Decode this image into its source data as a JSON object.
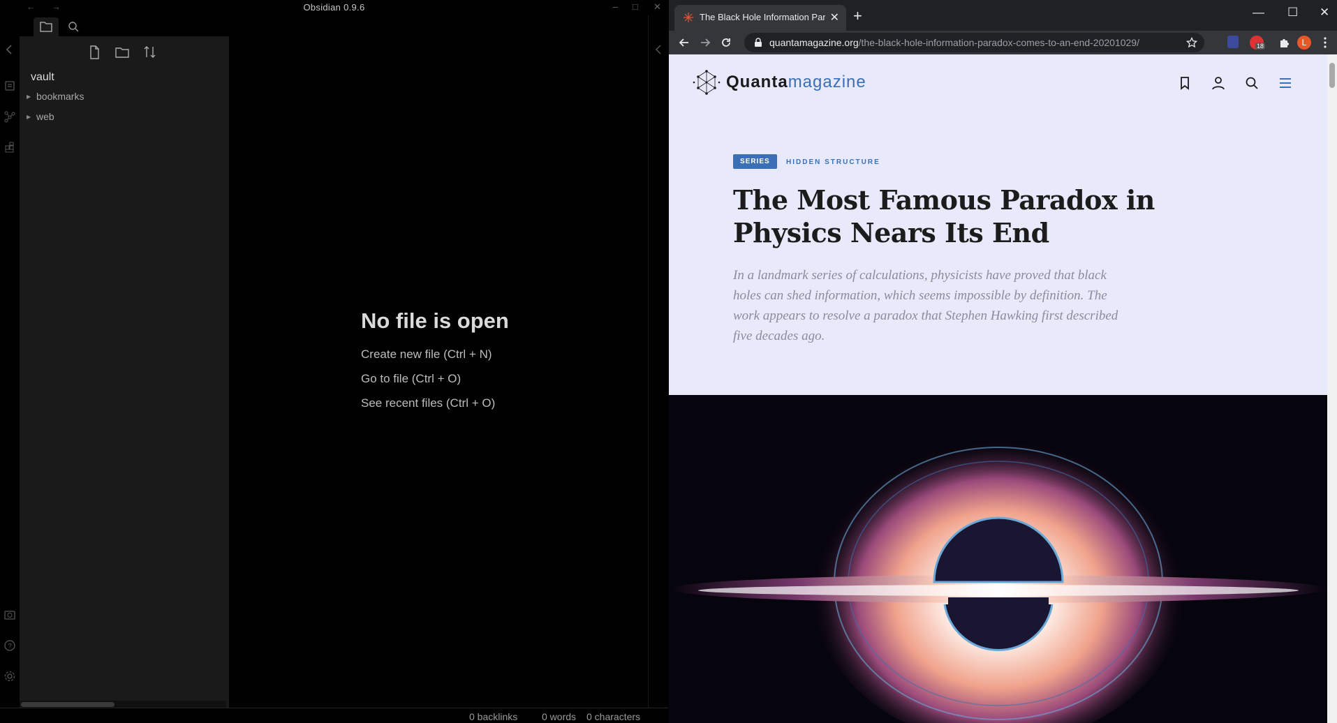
{
  "obsidian": {
    "title": "Obsidian 0.9.6",
    "nav": {
      "back": "←",
      "forward": "→"
    },
    "window": {
      "minimize": "–",
      "maximize": "□",
      "close": "✕"
    },
    "vault_name": "vault",
    "tree": [
      {
        "label": "bookmarks"
      },
      {
        "label": "web"
      }
    ],
    "empty_state": {
      "title": "No file is open",
      "links": [
        "Create new file (Ctrl + N)",
        "Go to file (Ctrl + O)",
        "See recent files (Ctrl + O)"
      ]
    },
    "status": {
      "backlinks": "0 backlinks",
      "words": "0 words",
      "characters": "0 characters"
    }
  },
  "chrome": {
    "tab_title": "The Black Hole Information Paradox Comes to an End",
    "tab_close": "✕",
    "new_tab": "+",
    "window": {
      "minimize": "—",
      "maximize": "☐",
      "close": "✕"
    },
    "url_host": "quantamagazine.org",
    "url_path": "/the-black-hole-information-paradox-comes-to-an-end-20201029/",
    "extension_badge": "18",
    "profile_initial": "L"
  },
  "article": {
    "brand_bold": "Quanta",
    "brand_light": "magazine",
    "series_badge": "SERIES",
    "series_name": "HIDDEN STRUCTURE",
    "headline": "The Most Famous Paradox in Physics Nears Its End",
    "dek": "In a landmark series of calculations, physicists have proved that black holes can shed information, which seems impossible by definition. The work appears to resolve a paradox that Stephen Hawking first described five decades ago."
  },
  "colors": {
    "quanta_blue": "#3b6fb6",
    "page_bg": "#e8e9fb",
    "profile": "#e8572a"
  }
}
